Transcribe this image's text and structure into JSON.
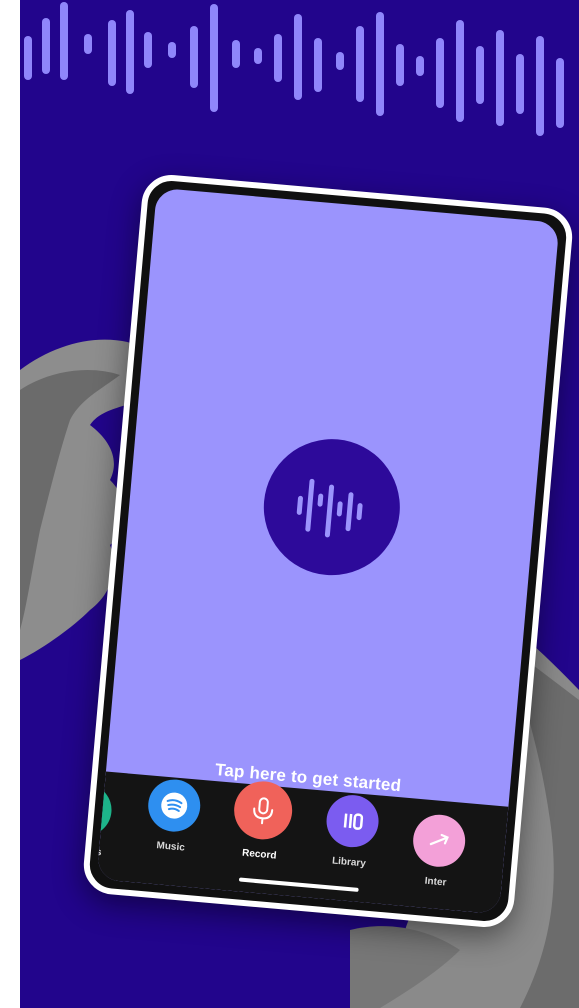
{
  "screen": {
    "prompt": "Tap here to get started"
  },
  "nav": {
    "items": [
      {
        "label": "essages",
        "icon": "messages-icon",
        "color": "#1db48a"
      },
      {
        "label": "Music",
        "icon": "spotify-icon",
        "color": "#2e8ff0"
      },
      {
        "label": "Record",
        "icon": "microphone-icon",
        "color": "#f0625a"
      },
      {
        "label": "Library",
        "icon": "library-icon",
        "color": "#7b5cf0"
      },
      {
        "label": "Inter",
        "icon": "interviews-icon",
        "color": "#f3a0d8"
      }
    ]
  },
  "colors": {
    "background": "#22058c",
    "screen": "#9b94fd",
    "logo_circle": "#2d0a9a",
    "waveform": "#8f86fb",
    "navbar": "#141414"
  }
}
